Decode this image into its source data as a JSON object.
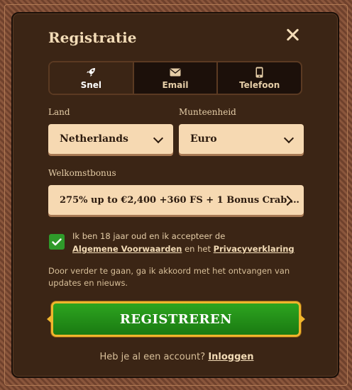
{
  "header": {
    "title": "Registratie"
  },
  "tabs": [
    {
      "label": "Snel",
      "icon": "rocket-icon"
    },
    {
      "label": "Email",
      "icon": "envelope-icon"
    },
    {
      "label": "Telefoon",
      "icon": "phone-icon"
    }
  ],
  "form": {
    "country_label": "Land",
    "country_value": "Netherlands",
    "currency_label": "Munteenheid",
    "currency_value": "Euro",
    "bonus_label": "Welkomstbonus",
    "bonus_value": "275% up to €2,400 +360 FS + 1 Bonus Crab …"
  },
  "consent": {
    "checked": true,
    "text_prefix": "Ik ben 18 jaar oud en ik accepteer de",
    "terms_link": "Algemene Voorwaarden",
    "text_mid": "en het",
    "privacy_link": "Privacyverklaring"
  },
  "note": "Door verder te gaan, ga ik akkoord met het ontvangen van updates en nieuws.",
  "register_button": "REGISTREREN",
  "footer": {
    "question": "Heb je al een account?",
    "login_link": "Inloggen"
  },
  "colors": {
    "accent": "#2da41f",
    "panel": "#3b2515",
    "field": "#f6d9b2",
    "gold": "#f0b52c"
  }
}
